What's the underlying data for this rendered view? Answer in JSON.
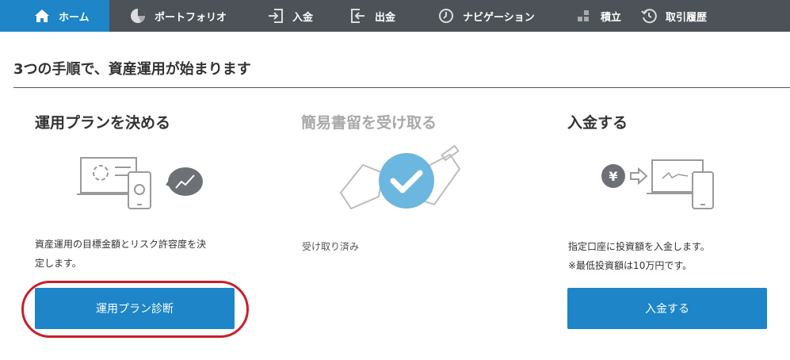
{
  "nav": {
    "items": [
      {
        "label": "ホーム",
        "icon": "home-icon"
      },
      {
        "label": "ポートフォリオ",
        "icon": "pie-chart-icon"
      },
      {
        "label": "入金",
        "icon": "deposit-icon"
      },
      {
        "label": "出金",
        "icon": "withdraw-icon"
      },
      {
        "label": "ナビゲーション",
        "icon": "navigation-clock-icon"
      },
      {
        "label": "積立",
        "icon": "accumulation-icon"
      },
      {
        "label": "取引履歴",
        "icon": "history-icon"
      }
    ]
  },
  "page": {
    "title": "3つの手順で、資産運用が始まります"
  },
  "steps": [
    {
      "title": "運用プランを決める",
      "desc_line1": "資産運用の目標金額とリスク許容度を決",
      "desc_line2": "定します。",
      "button": "運用プラン診断"
    },
    {
      "title": "簡易書留を受け取る",
      "status": "受け取り済み"
    },
    {
      "title": "入金する",
      "desc_line1": "指定口座に投資額を入金します。",
      "desc_line2": "※最低投資額は10万円です。",
      "button": "入金する",
      "yen_symbol": "¥"
    }
  ],
  "colors": {
    "nav_bg": "#4c5257",
    "accent": "#1d85c8",
    "highlight": "#c8202a",
    "check_circle": "#6bb7df"
  }
}
